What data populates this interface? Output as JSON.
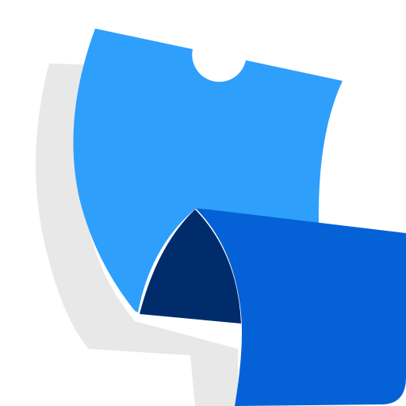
{
  "logo": {
    "name": "folded-ribbon-logo",
    "colors": {
      "background": "#ffffff",
      "shadow": "#e8e8e8",
      "light_blue": "#2f9ffc",
      "mid_blue": "#0462d6",
      "dark_navy": "#002c6c"
    }
  }
}
